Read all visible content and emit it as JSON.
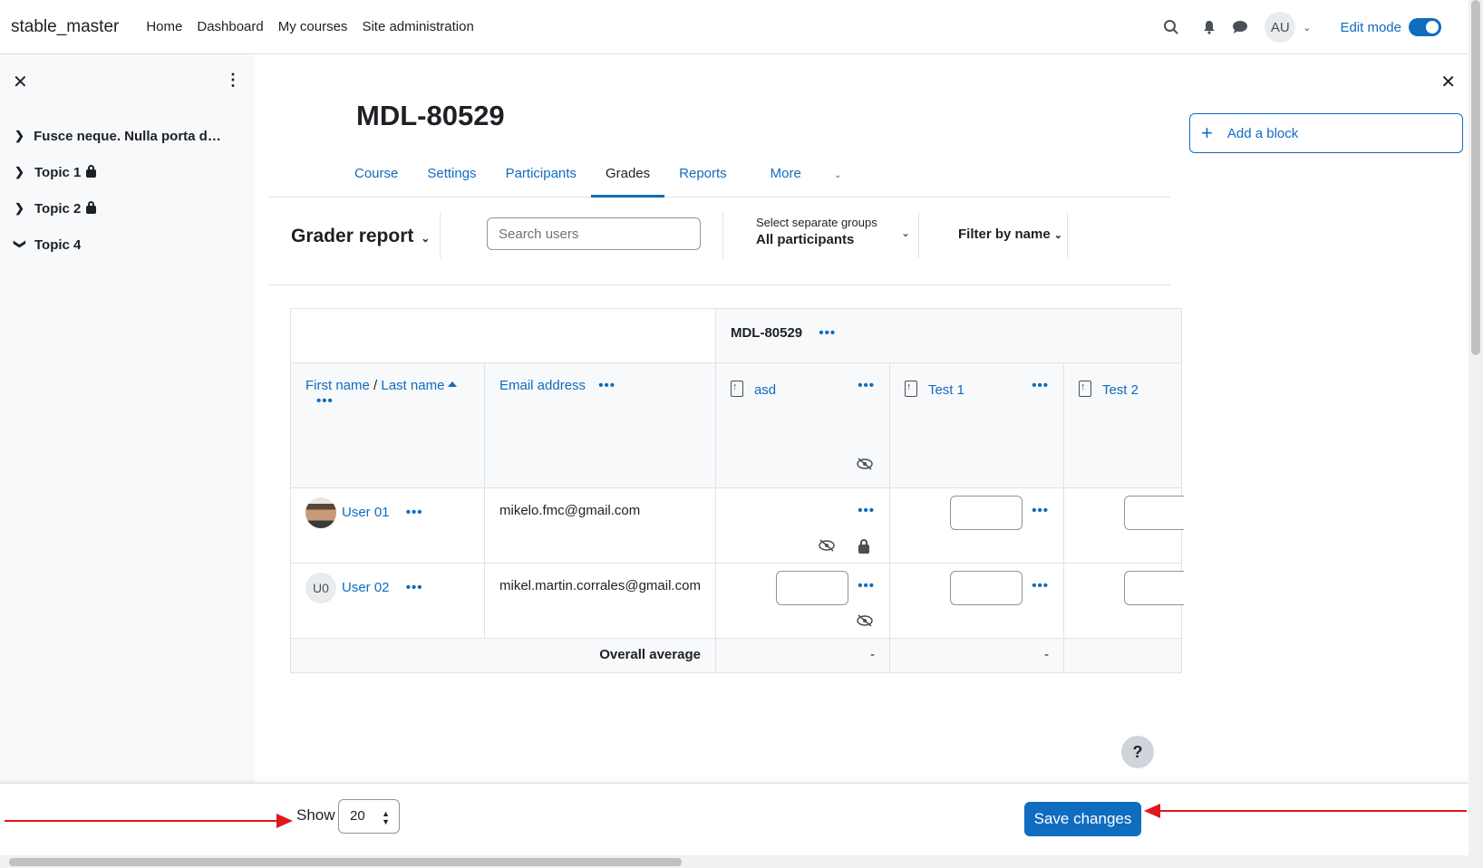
{
  "navbar": {
    "brand": "stable_master",
    "links": [
      "Home",
      "Dashboard",
      "My courses",
      "Site administration"
    ],
    "user_initials": "AU",
    "edit_mode_label": "Edit mode",
    "edit_mode_on": true
  },
  "course_index": {
    "items": [
      {
        "label": "Fusce neque. Nulla porta dol...",
        "locked": false,
        "expanded": false
      },
      {
        "label": "Topic 1",
        "locked": true,
        "expanded": false
      },
      {
        "label": "Topic 2",
        "locked": true,
        "expanded": false
      },
      {
        "label": "Topic 4",
        "locked": false,
        "expanded": true
      }
    ]
  },
  "right_drawer": {
    "add_block_label": "Add a block"
  },
  "page": {
    "title": "MDL-80529",
    "tabs": [
      {
        "label": "Course",
        "active": false
      },
      {
        "label": "Settings",
        "active": false
      },
      {
        "label": "Participants",
        "active": false
      },
      {
        "label": "Grades",
        "active": true
      },
      {
        "label": "Reports",
        "active": false
      },
      {
        "label": "More",
        "active": false
      }
    ]
  },
  "tertiary": {
    "report_title": "Grader report",
    "search_placeholder": "Search users",
    "groups_label": "Select separate groups",
    "groups_value": "All participants",
    "filter_label": "Filter by name"
  },
  "grader": {
    "category_name": "MDL-80529",
    "header_first": "First name",
    "header_sep": " / ",
    "header_last": "Last name",
    "header_email": "Email address",
    "items": [
      "asd",
      "Test 1",
      "Test 2"
    ],
    "users": [
      {
        "name": "User 01",
        "initials": "",
        "email": "mikelo.fmc@gmail.com"
      },
      {
        "name": "User 02",
        "initials": "U0",
        "email": "mikel.martin.corrales@gmail.com"
      }
    ],
    "overall_average_label": "Overall average",
    "overall_average_values": [
      "-",
      "-"
    ]
  },
  "footer": {
    "show_label": "Show",
    "per_page_value": "20",
    "save_label": "Save changes"
  },
  "help_label": "?",
  "colors": {
    "primary": "#0f6cbf",
    "annotation_arrow": "#e0161b"
  }
}
